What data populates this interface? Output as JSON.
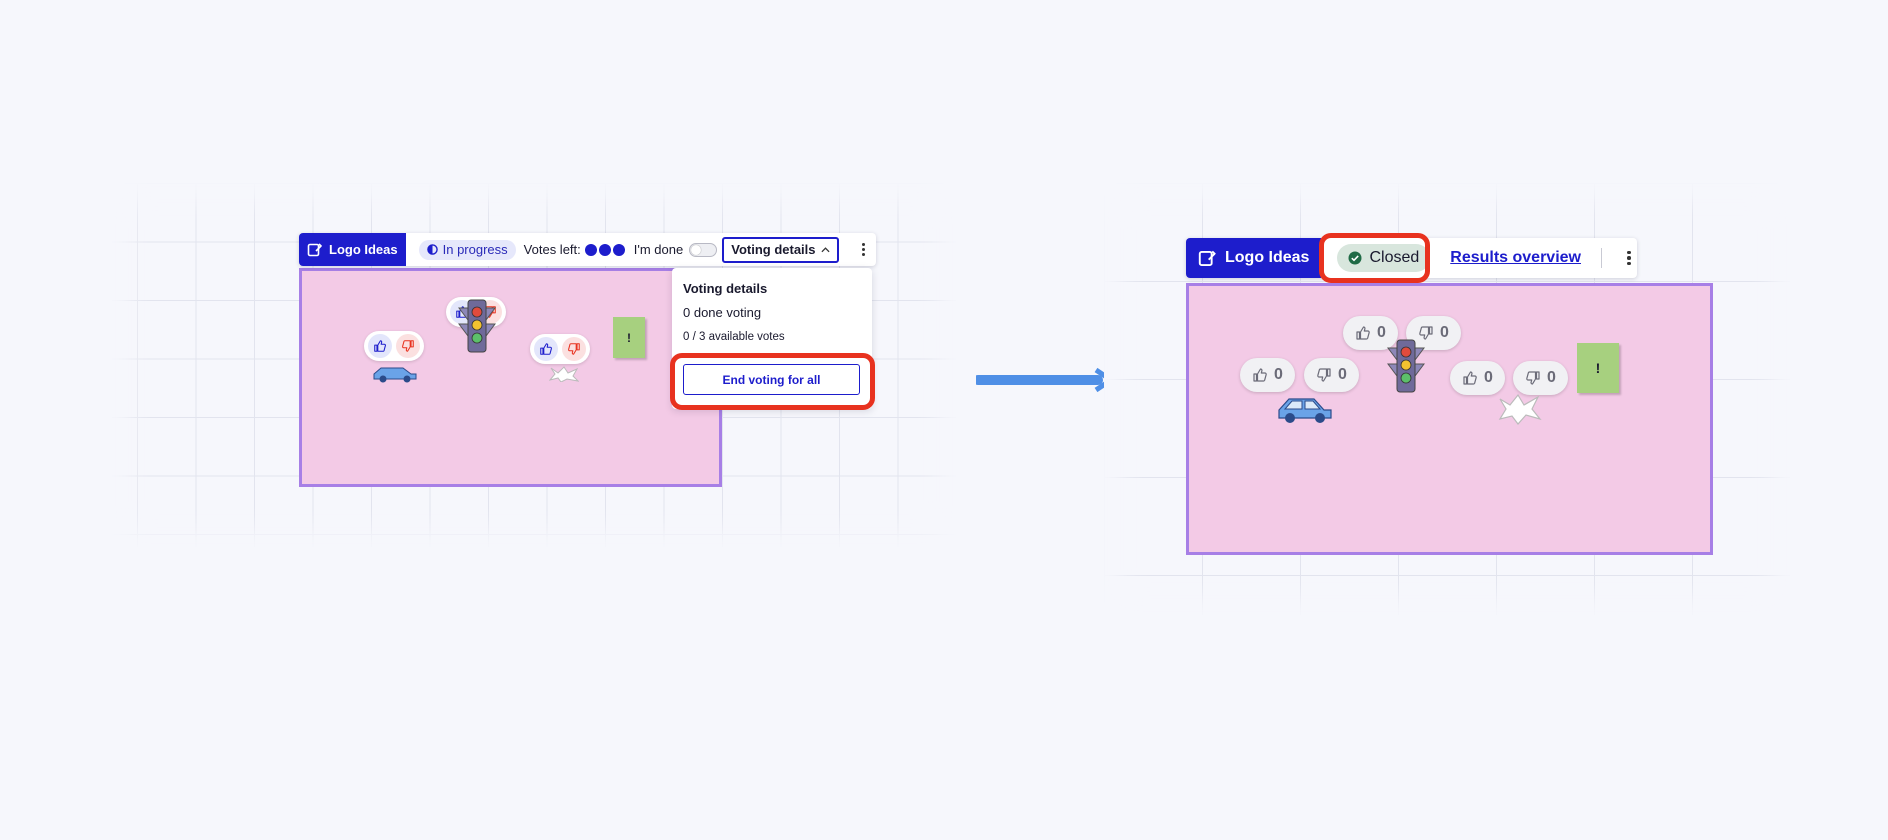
{
  "before": {
    "frame_title": "Logo Ideas",
    "status": "In progress",
    "votes_left_label": "Votes left:",
    "votes_left_count": 3,
    "im_done_label": "I'm done",
    "voting_details_button": "Voting details",
    "popover": {
      "title": "Voting details",
      "done_voting": "0 done voting",
      "available_votes": "0 / 3 available votes",
      "end_button": "End voting for all"
    },
    "sticky_text": "!"
  },
  "after": {
    "frame_title": "Logo Ideas",
    "status": "Closed",
    "results_link": "Results overview",
    "sticky_text": "!",
    "counts": {
      "light_up": "0",
      "light_down": "0",
      "car_up": "0",
      "car_down": "0",
      "splash_up": "0",
      "splash_down": "0"
    }
  },
  "colors": {
    "accent": "#1d1dcc",
    "highlight": "#e8321f",
    "frame_fill": "#f3cae6",
    "frame_border": "#a77fe6",
    "sticky": "#a7d07f",
    "arrow": "#4f8fe6"
  },
  "icons": [
    "frame-icon",
    "half-circle-icon",
    "chevron-up-icon",
    "kebab-icon",
    "thumbs-up-icon",
    "thumbs-down-icon",
    "check-circle-icon",
    "car-icon",
    "traffic-light-icon",
    "splash-icon",
    "arrow-right-icon"
  ]
}
